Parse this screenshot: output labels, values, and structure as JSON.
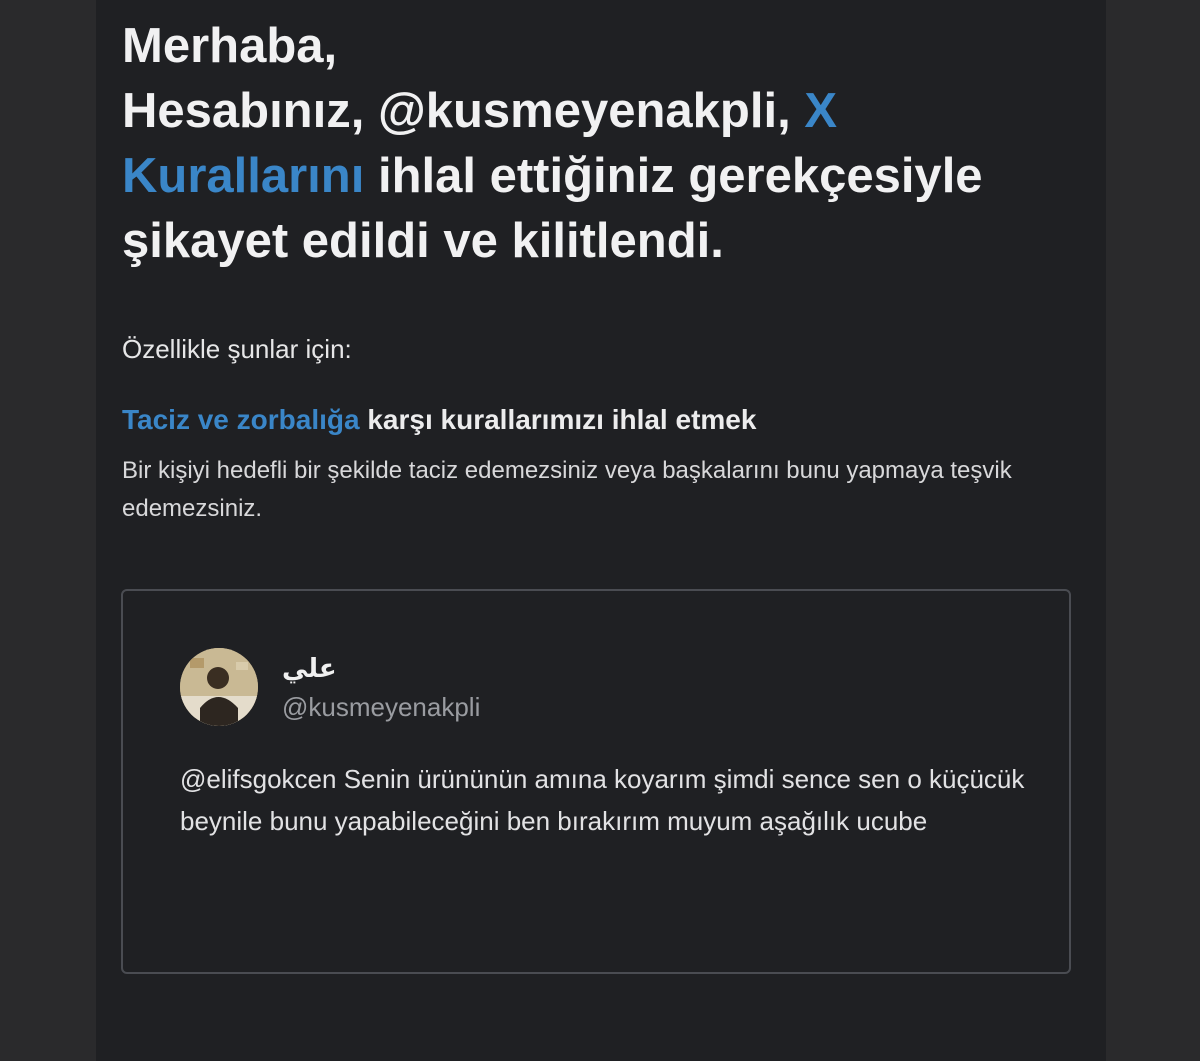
{
  "headline": {
    "line1": "Merhaba,",
    "line2_prefix": "Hesabınız, @kusmeyenakpli, ",
    "rules_link": "X Kurallarını",
    "line2_suffix": " ihlal ettiğiniz gerekçesiyle şikayet edildi ve kilitlendi."
  },
  "intro": "Özellikle şunlar için:",
  "rule": {
    "link": "Taciz ve zorbalığa",
    "suffix": " karşı kurallarımızı ihlal etmek",
    "description": "Bir kişiyi hedefli bir şekilde taciz edemezsiniz veya başkalarını bunu yapmaya teşvik edemezsiniz."
  },
  "tweet": {
    "display_name": "علي",
    "handle": "@kusmeyenakpli",
    "text": "@elifsgokcen Senin ürününün amına koyarım şimdi sence sen o küçücük beynile bunu yapabileceğini ben bırakırım muyum aşağılık ucube",
    "avatar_icon": "profile-photo"
  },
  "colors": {
    "background": "#1f2023",
    "link": "#3a86c8",
    "border": "#4a4c52"
  }
}
